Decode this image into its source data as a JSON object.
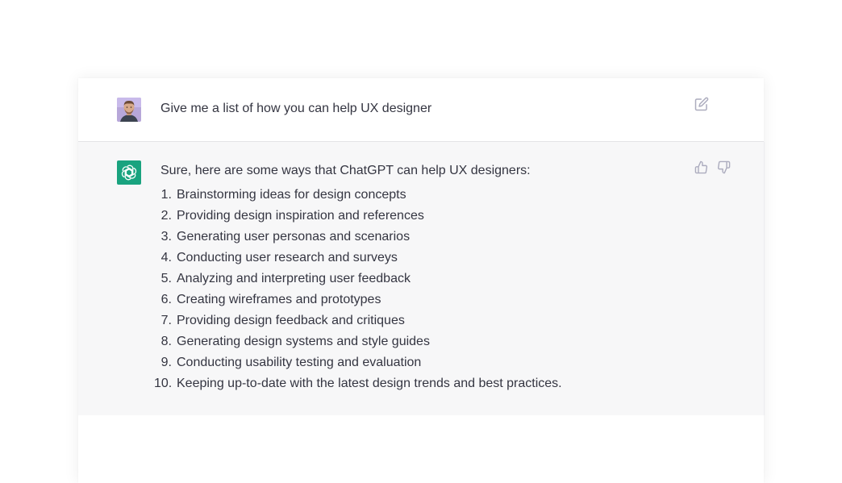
{
  "conversation": {
    "user_message": "Give me a list of how you can help UX designer",
    "assistant_intro": "Sure, here are some ways that ChatGPT can help UX designers:",
    "assistant_items": [
      {
        "num": "1.",
        "text": "Brainstorming ideas for design concepts"
      },
      {
        "num": "2.",
        "text": "Providing design inspiration and references"
      },
      {
        "num": "3.",
        "text": "Generating user personas and scenarios"
      },
      {
        "num": "4.",
        "text": "Conducting user research and surveys"
      },
      {
        "num": "5.",
        "text": "Analyzing and interpreting user feedback"
      },
      {
        "num": "6.",
        "text": "Creating wireframes and prototypes"
      },
      {
        "num": "7.",
        "text": "Providing design feedback and critiques"
      },
      {
        "num": "8.",
        "text": "Generating design systems and style guides"
      },
      {
        "num": "9.",
        "text": "Conducting usability testing and evaluation"
      },
      {
        "num": "10.",
        "text": "Keeping up-to-date with the latest design trends and best practices."
      }
    ]
  },
  "icons": {
    "user_avatar": "user-avatar",
    "assistant_avatar": "chatgpt-logo-icon",
    "edit": "edit-icon",
    "thumbs_up": "thumbs-up-icon",
    "thumbs_down": "thumbs-down-icon"
  },
  "colors": {
    "assistant_background": "#f7f7f8",
    "chatgpt_brand": "#19a37f",
    "text": "#343541",
    "icon_gray": "#acacbe"
  }
}
